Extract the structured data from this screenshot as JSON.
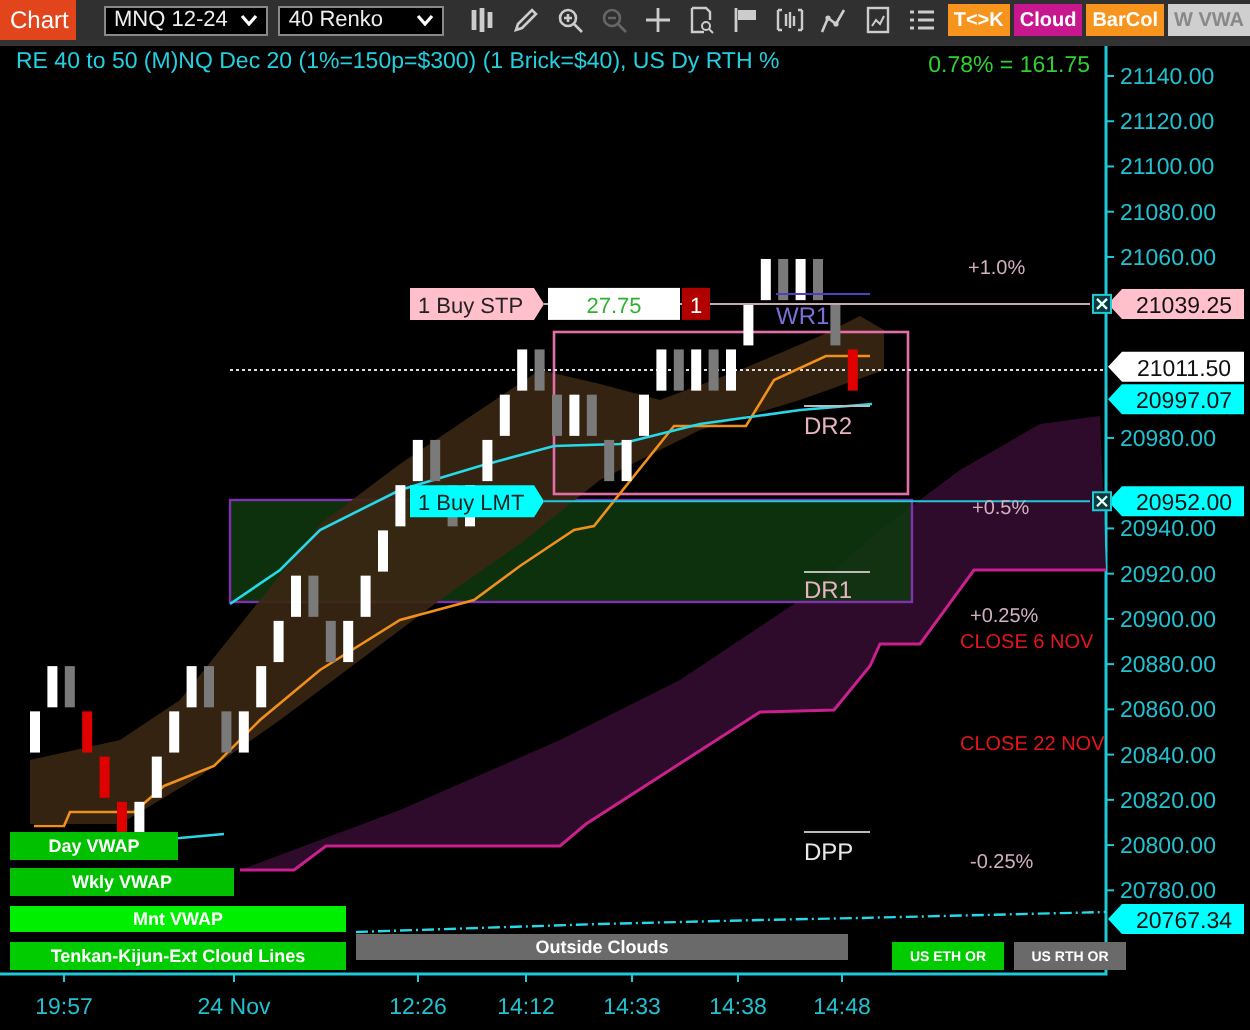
{
  "toolbar": {
    "title": "Chart",
    "instrument": "MNQ 12-24",
    "bar_type": "40 Renko",
    "buttons": [
      {
        "label": "T<>K",
        "color": "#f7941d"
      },
      {
        "label": "Cloud",
        "color": "#c8178e"
      },
      {
        "label": "BarCol",
        "color": "#f7941d"
      },
      {
        "label": "W VWA",
        "color": "#cfcfcf"
      }
    ]
  },
  "chart": {
    "title": "RE 40 to 50 (M)NQ Dec 20 (1%=150p=$300) (1 Brick=$40), US Dy RTH %",
    "change": "0.78% = 161.75",
    "price_axis": [
      "21140.00",
      "21120.00",
      "21100.00",
      "21080.00",
      "21060.00",
      "20980.00",
      "20940.00",
      "20920.00",
      "20900.00",
      "20880.00",
      "20860.00",
      "20840.00",
      "20820.00",
      "20800.00",
      "20780.00"
    ],
    "price_badges": [
      {
        "value": "21039.25",
        "color": "#ffc0cb"
      },
      {
        "value": "21011.50",
        "color": "#ffffff"
      },
      {
        "value": "20997.07",
        "color": "#00ffff"
      },
      {
        "value": "20952.00",
        "color": "#00ffff"
      },
      {
        "value": "20767.34",
        "color": "#00ffff"
      }
    ],
    "time_axis": [
      "19:57",
      "24 Nov",
      "12:26",
      "14:12",
      "14:33",
      "14:38",
      "14:48"
    ],
    "orders": [
      {
        "label": "1 Buy STP",
        "kind": "stop",
        "price": "27.75",
        "quantity": "1"
      },
      {
        "label": "1 Buy LMT",
        "kind": "limit"
      }
    ],
    "levels": [
      {
        "label": "+1.0%",
        "kind": "percent"
      },
      {
        "label": "WR1",
        "kind": "weekly"
      },
      {
        "label": "DR2",
        "kind": "daily"
      },
      {
        "label": "+0.5%",
        "kind": "percent"
      },
      {
        "label": "DR1",
        "kind": "daily"
      },
      {
        "label": "+0.25%",
        "kind": "percent"
      },
      {
        "label": "CLOSE 6 NOV",
        "kind": "close"
      },
      {
        "label": "CLOSE 22 NOV",
        "kind": "close"
      },
      {
        "label": "DPP",
        "kind": "pivot"
      },
      {
        "label": "-0.25%",
        "kind": "percent"
      }
    ],
    "legend": [
      {
        "label": "Day VWAP",
        "active": true
      },
      {
        "label": "Wkly VWAP",
        "active": true
      },
      {
        "label": "Mnt VWAP",
        "active": true
      },
      {
        "label": "Tenkan-Kijun-Ext Cloud Lines",
        "active": true
      },
      {
        "label": "Outside Clouds",
        "active": false
      },
      {
        "label": "US ETH OR",
        "active": true
      },
      {
        "label": "US RTH OR",
        "active": false
      }
    ]
  }
}
